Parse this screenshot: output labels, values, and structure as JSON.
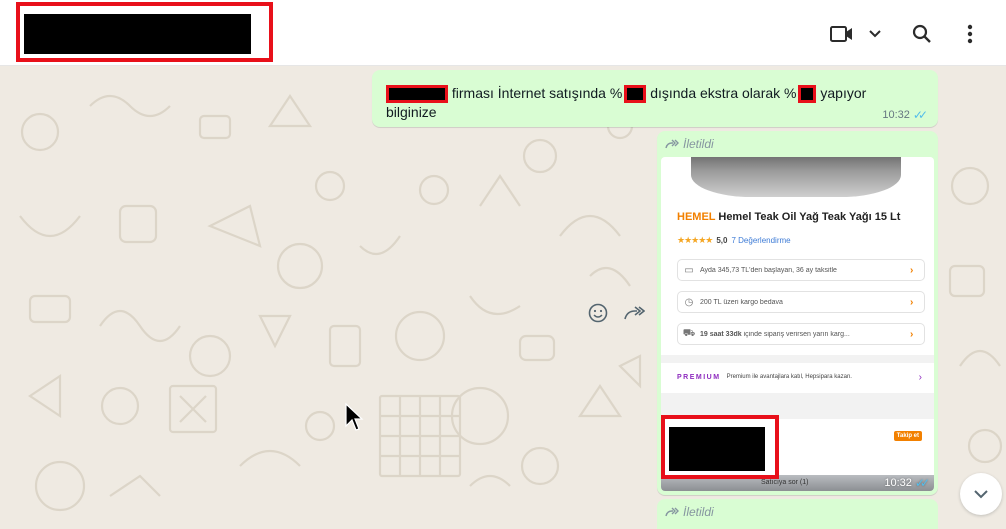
{
  "colors": {
    "wallpaper": "#efeae2",
    "outgoing_bubble": "#d9fdd3",
    "redaction_frame": "#e8101a",
    "read_ticks": "#53bdeb",
    "brand_orange": "#f28000",
    "premium_purple": "#8e2bbf"
  },
  "header": {
    "contact_name_redacted": true,
    "video_call_icon": "video-camera-icon",
    "dropdown_icon": "chevron-down-icon",
    "search_icon": "search-icon",
    "menu_icon": "kebab-menu-icon"
  },
  "messages": {
    "first": {
      "part1": "firması İnternet satışında %",
      "part2": "dışında ekstra olarak %",
      "part3": "yapıyor",
      "part4": "bilginize",
      "time": "10:32"
    },
    "forwarded": {
      "label": "İletildi",
      "time": "10:32",
      "screenshot": {
        "brand": "HEMEL",
        "title": "Hemel Teak Oil Yağ Teak Yağı 15 Lt",
        "rating_score": "5,0",
        "rating_reviews": "7 Değerlendirme",
        "stars": "★★★★★",
        "rows": [
          {
            "icon": "card-icon",
            "text": "Ayda 345,73 TL'den başlayan, 36 ay taksitle"
          },
          {
            "icon": "cargo-icon",
            "text": "200 TL üzeri kargo bedava"
          },
          {
            "icon": "truck-icon",
            "text_bold": "19 saat 33dk",
            "text": " içinde sipariş verirsen yarın karg..."
          }
        ],
        "premium_logo": "PREMIUM",
        "premium_text": "Premium ile avantajlara katıl, Hepsipara kazan.",
        "follow_badge": "Takip et",
        "bottom_label": "Satıcıya sor (1)"
      }
    },
    "second_forwarded": {
      "label": "İletildi"
    }
  },
  "actions": {
    "emoji_icon": "emoji-icon",
    "forward_icon": "forward-icon",
    "scroll_down_icon": "chevron-down-icon"
  }
}
